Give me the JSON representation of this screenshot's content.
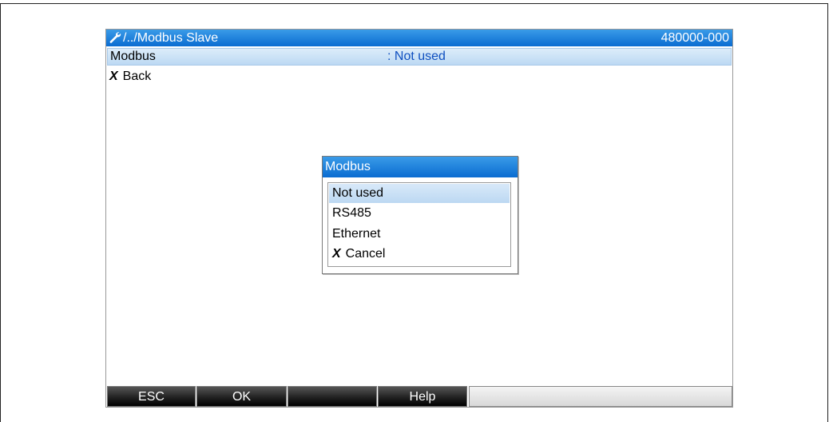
{
  "title_bar": {
    "path": "/../Modbus Slave",
    "device_id": "480000-000"
  },
  "setting_row": {
    "label": "Modbus",
    "value": ": Not used"
  },
  "back_row": {
    "label": "Back"
  },
  "dialog": {
    "title": "Modbus",
    "options": [
      "Not used",
      "RS485",
      "Ethernet"
    ],
    "selected_index": 0,
    "cancel_label": "Cancel"
  },
  "softkeys": [
    "ESC",
    "OK",
    "",
    "Help",
    ""
  ],
  "colors": {
    "title_blue": "#0a6cd1",
    "value_blue": "#1050c0",
    "selection": "#bcd9f3"
  },
  "icons": [
    "wrench-icon",
    "x-mark-icon"
  ]
}
